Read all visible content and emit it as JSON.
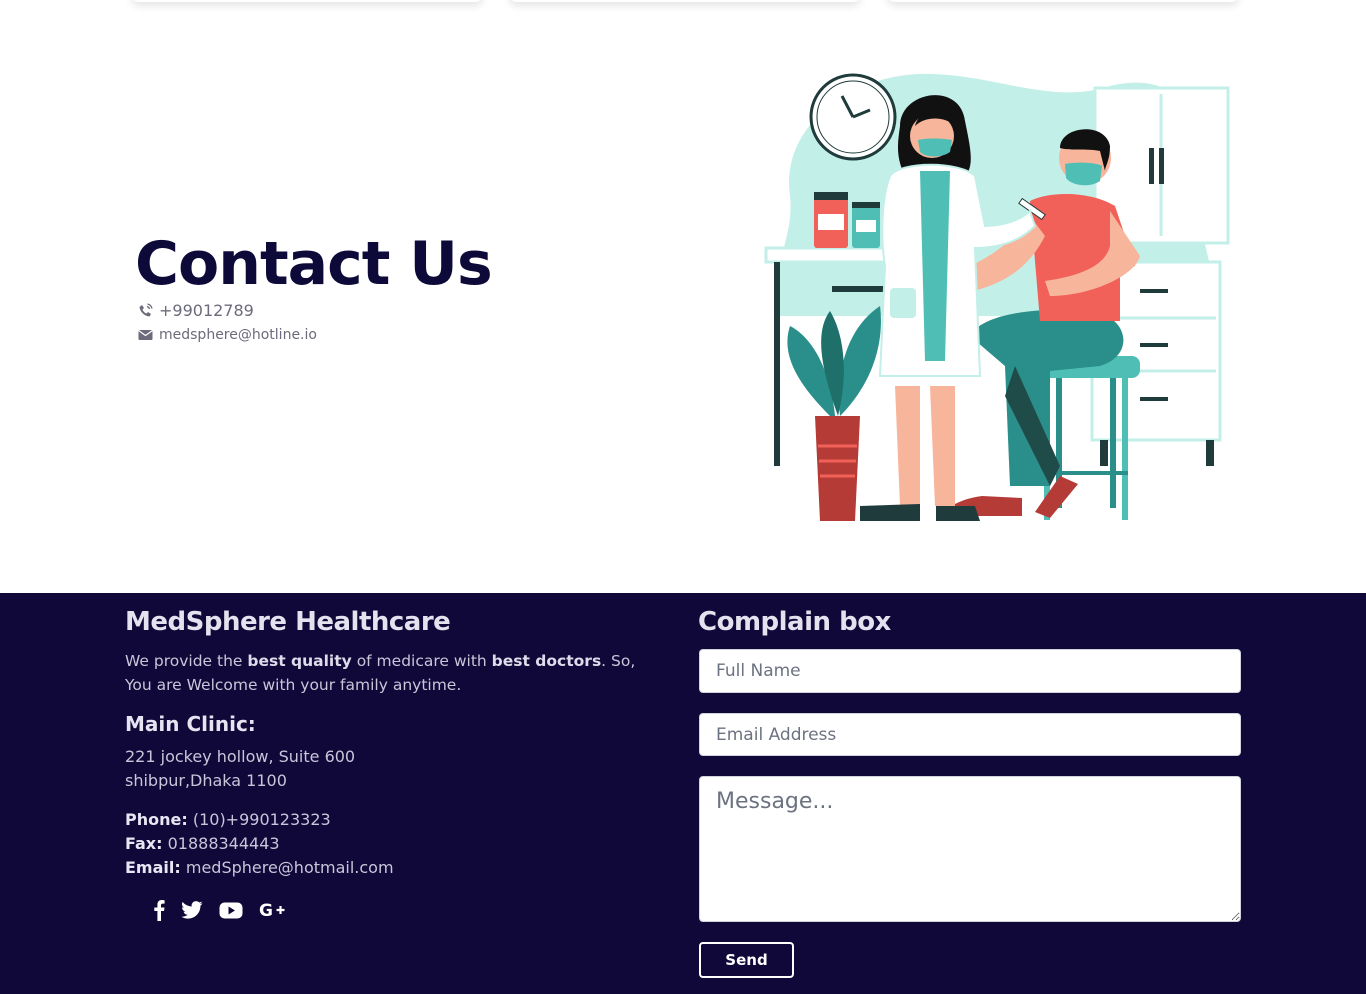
{
  "contact": {
    "title": "Contact Us",
    "phone": "+99012789",
    "email": "medsphere@hotline.io"
  },
  "footer": {
    "brand": "MedSphere Healthcare",
    "about": {
      "p1": "We provide the ",
      "b1": "best quality",
      "p2": " of medicare with ",
      "b2": "best doctors",
      "p3": ". So, You are Welcome with your family anytime."
    },
    "clinic_title": "Main Clinic:",
    "address_line1": "221 jockey hollow, Suite 600",
    "address_line2": "shibpur,Dhaka 1100",
    "phone_label": "Phone:",
    "phone_value": " (10)+990123323",
    "fax_label": "Fax:",
    "fax_value": " 01888344443",
    "email_label": "Email:",
    "email_value": " medSphere@hotmail.com",
    "socials": [
      "facebook-icon",
      "twitter-icon",
      "youtube-icon",
      "google-plus-icon"
    ]
  },
  "complain": {
    "title": "Complain box",
    "name_placeholder": "Full Name",
    "email_placeholder": "Email Address",
    "message_placeholder": "Message...",
    "send_label": "Send"
  },
  "colors": {
    "navy": "#0f0838",
    "title": "#0d0a3a",
    "teal": "#2a8f8a",
    "mint": "#c3efe9",
    "coral": "#f2605a"
  }
}
